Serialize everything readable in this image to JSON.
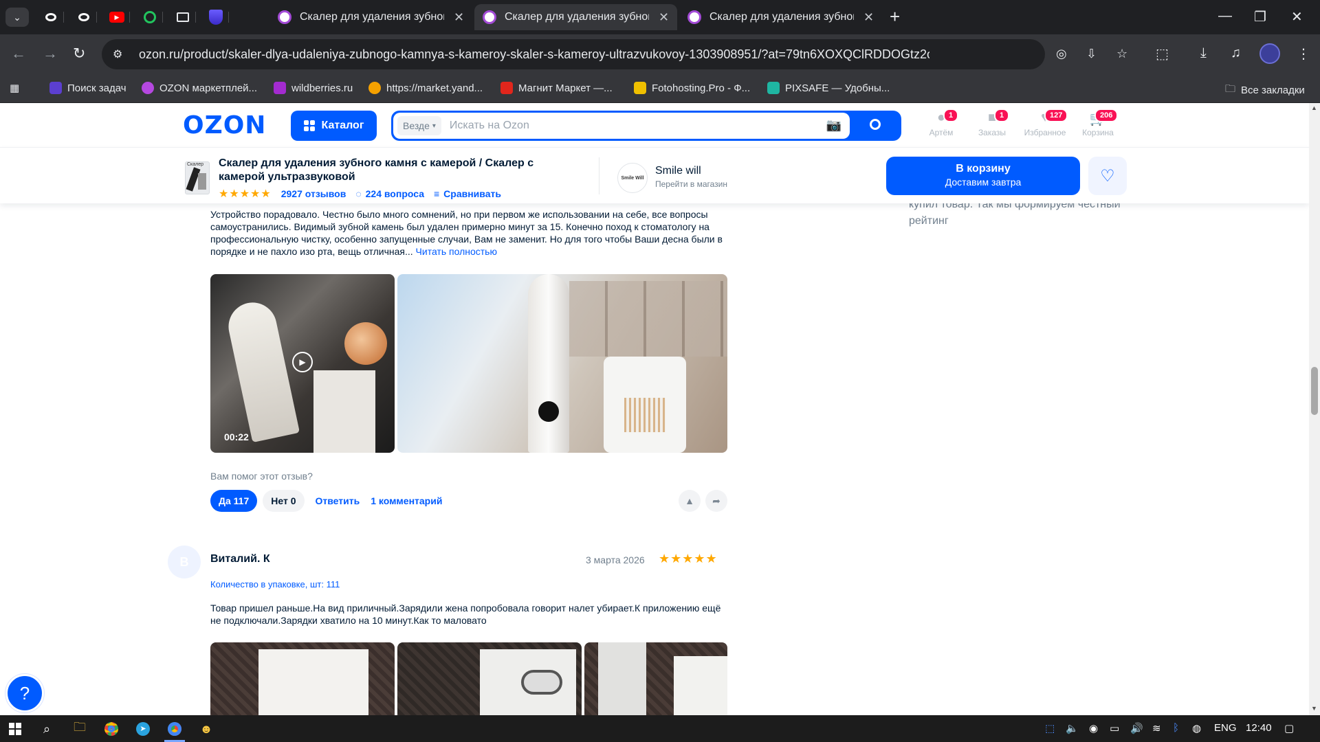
{
  "browser": {
    "tabs": [
      {
        "title": "Скалер для удаления зубного",
        "active": false
      },
      {
        "title": "Скалер для удаления зубного",
        "active": true
      },
      {
        "title": "Скалер для удаления зубного",
        "active": false
      }
    ],
    "new_tab_label": "+",
    "url": "ozon.ru/product/skaler-dlya-udaleniya-zubnogo-kamnya-s-kameroy-skaler-s-kameroy-ultrazvukovoy-1303908951/?at=79tn6XOXQClRDDOGtz2oylLiXlP0EWsP4L2nQiQl0...",
    "bookmarks": [
      {
        "label": "Поиск задач",
        "color": "#5b3fd0"
      },
      {
        "label": "OZON маркетплей...",
        "color": "#b548e0"
      },
      {
        "label": "wildberries.ru",
        "color": "#a32bd0"
      },
      {
        "label": "https://market.yand...",
        "color": "#f5a100"
      },
      {
        "label": "Магнит Маркет —...",
        "color": "#e1261c"
      },
      {
        "label": "Fotohosting.Pro - Ф...",
        "color": "#f0c000"
      },
      {
        "label": "PIXSAFE — Удобны...",
        "color": "#1fb6a2"
      }
    ],
    "all_bookmarks_label": "Все закладки"
  },
  "header": {
    "logo": "OZON",
    "catalog_label": "Каталог",
    "search_scope": "Везде",
    "search_placeholder": "Искать на Ozon",
    "items": [
      {
        "label": "Артём",
        "badge": "1"
      },
      {
        "label": "Заказы",
        "badge": "1"
      },
      {
        "label": "Избранное",
        "badge": "127"
      },
      {
        "label": "Корзина",
        "badge": "206"
      }
    ]
  },
  "product_bar": {
    "title": "Скалер для удаления зубного камня с камерой / Скалер с камерой ультразвуковой",
    "stars": "★★★★★",
    "reviews": "2927 отзывов",
    "questions": "224 вопроса",
    "compare": "Сравнивать",
    "thumb_label": "Скалер",
    "seller_name": "Smile will",
    "seller_logo_text": "Smile Will",
    "seller_link": "Перейти в магазин",
    "cart_label": "В корзину",
    "cart_sub": "Доставим завтра"
  },
  "side_note": "купил товар. Так мы формируем честный рейтинг",
  "review1": {
    "text": "Устройство порадовало. Честно было много сомнений, но при первом же использовании на себе, все вопросы самоустранились. Видимый зубной камень был удален примерно минут за 15. Конечно поход к стоматологу на профессиональную чистку, особенно запущенные случаи, Вам не заменит. Но для того чтобы Ваши десна были в порядке и не пахло изо рта, вещь отличная...",
    "read_more": "Читать полностью",
    "video_duration": "00:22",
    "helpful_question": "Вам помог этот отзыв?",
    "yes_label": "Да 117",
    "no_label": "Нет 0",
    "reply_label": "Ответить",
    "comments_label": "1 комментарий"
  },
  "review2": {
    "avatar_letter": "В",
    "author": "Виталий. К",
    "date": "3 марта 2026",
    "stars": "★★★★★",
    "variant": "Количество в упаковке, шт: 111",
    "text": "Товар пришел раньше.На вид приличный.Зарядили жена попробовала говорит налет убирает.К приложению ещё не подключали.Зарядки хватило на 10 минут.Как то маловато"
  },
  "taskbar": {
    "language": "ENG",
    "time": "12:40"
  }
}
